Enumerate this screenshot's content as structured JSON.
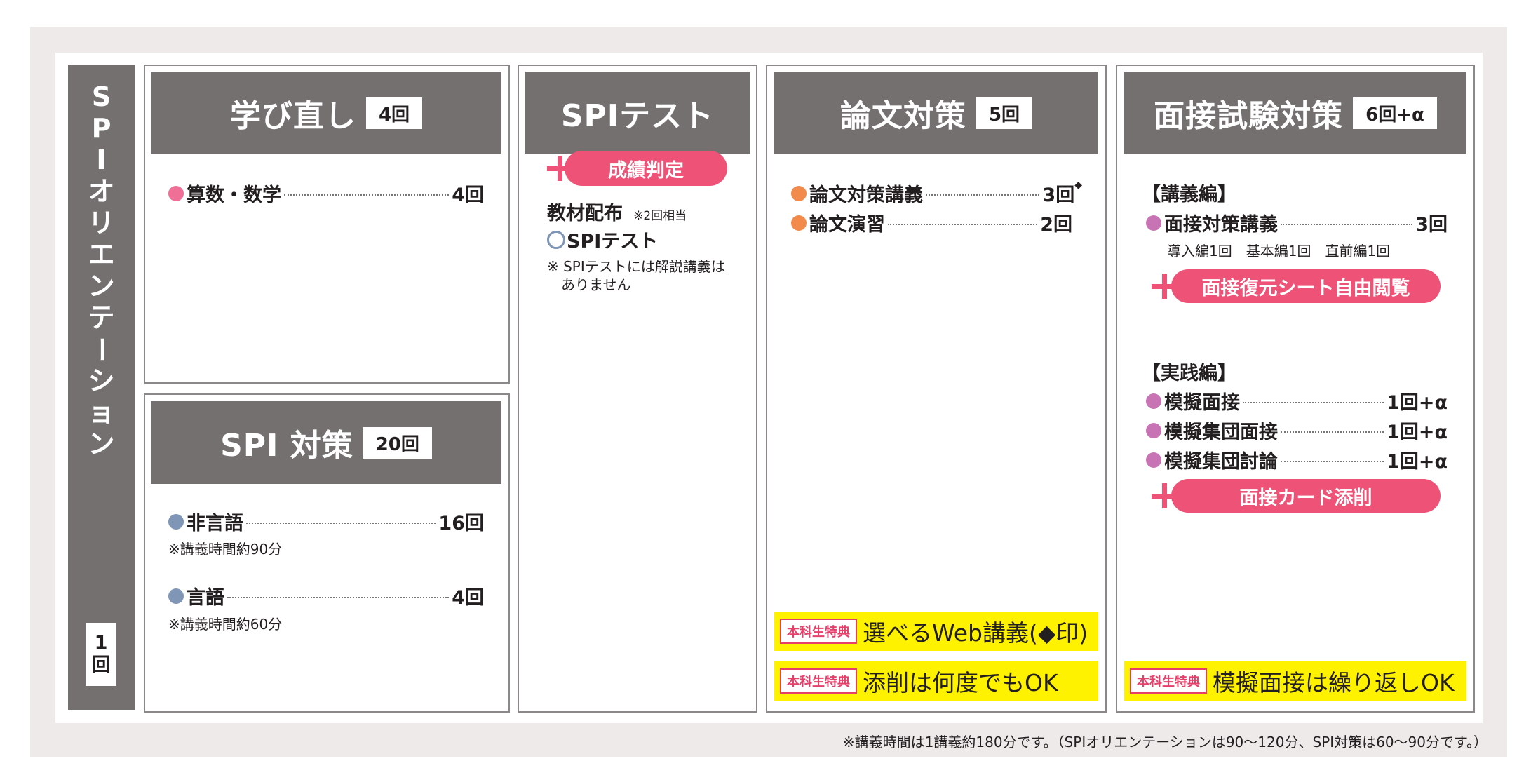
{
  "orientation": {
    "title_chars": [
      "S",
      "P",
      "I",
      "オ",
      "リ",
      "エ",
      "ン",
      "テ",
      "ー",
      "シ",
      "ョ",
      "ン"
    ],
    "count_top": "1",
    "count_bottom": "回"
  },
  "manabi": {
    "title": "学び直し",
    "badge": "4回",
    "items": [
      {
        "label": "算数・数学",
        "count": "4回"
      }
    ]
  },
  "spi_taisaku": {
    "title": "SPI 対策",
    "badge": "20回",
    "items": [
      {
        "label": "非言語",
        "count": "16回",
        "note": "※講義時間約90分"
      },
      {
        "label": "言語",
        "count": "4回",
        "note": "※講義時間約60分"
      }
    ]
  },
  "spi_test": {
    "title": "SPIテスト",
    "pill": "成績判定",
    "material": "教材配布",
    "material_note": "※2回相当",
    "test_label": "SPIテスト",
    "note_line1": "※ SPIテストには解説講義は",
    "note_line2": "ありません"
  },
  "ronbun": {
    "title": "論文対策",
    "badge": "5回",
    "items": [
      {
        "label": "論文対策講義",
        "count": "3回",
        "mark": "◆"
      },
      {
        "label": "論文演習",
        "count": "2回"
      }
    ],
    "perks": [
      {
        "tag": "本科生特典",
        "text": "選べるWeb講義(◆印)"
      },
      {
        "tag": "本科生特典",
        "text": "添削は何度でもOK"
      }
    ]
  },
  "mensetsu": {
    "title": "面接試験対策",
    "badge": "6回+α",
    "lecture_heading": "【講義編】",
    "lecture_item": {
      "label": "面接対策講義",
      "count": "3回"
    },
    "lecture_sub": "導入編1回　基本編1回　直前編1回",
    "pill1": "面接復元シート自由閲覧",
    "practice_heading": "【実践編】",
    "practice_items": [
      {
        "label": "模擬面接",
        "count": "1回+α"
      },
      {
        "label": "模擬集団面接",
        "count": "1回+α"
      },
      {
        "label": "模擬集団討論",
        "count": "1回+α"
      }
    ],
    "pill2": "面接カード添削",
    "perk": {
      "tag": "本科生特典",
      "text": "模擬面接は繰り返しOK"
    }
  },
  "footnote": "※講義時間は1講義約180分です。（SPIオリエンテーションは90～120分、SPI対策は60～90分です。）",
  "colors": {
    "header": "#747070",
    "pink_dot": "#ef6f96",
    "blue_dot": "#7f96b6",
    "orange_dot": "#f28a4c",
    "purple_dot": "#c873b4",
    "pill": "#ee5377",
    "yellow": "#fff200"
  }
}
